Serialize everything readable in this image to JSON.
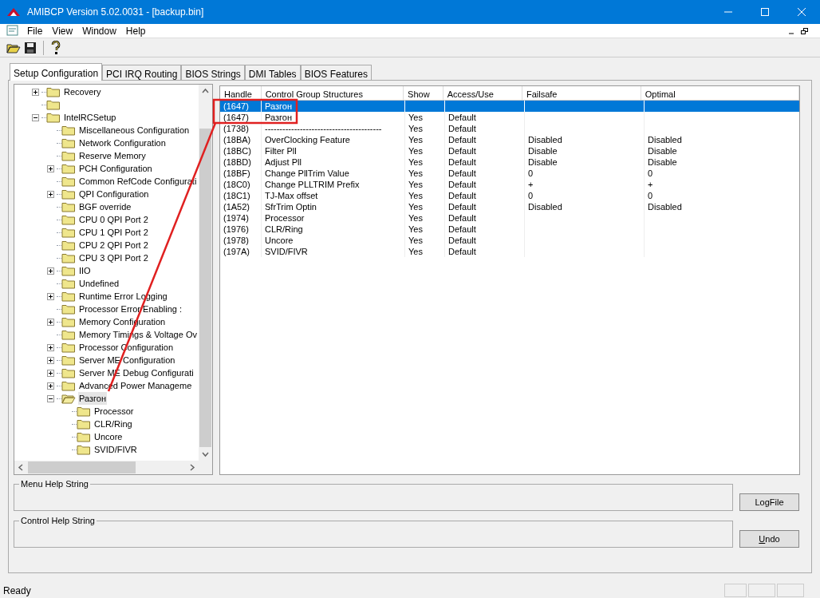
{
  "window": {
    "title": "AMIBCP Version 5.02.0031 - [backup.bin]"
  },
  "menu": [
    "File",
    "View",
    "Window",
    "Help"
  ],
  "tabs": [
    {
      "label": "Setup Configuration",
      "selected": true
    },
    {
      "label": "PCI IRQ Routing",
      "selected": false
    },
    {
      "label": "BIOS Strings",
      "selected": false
    },
    {
      "label": "DMI Tables",
      "selected": false
    },
    {
      "label": "BIOS Features",
      "selected": false
    }
  ],
  "tree": [
    {
      "label": "Recovery",
      "kind": "branch",
      "expanded": false,
      "selected": false
    },
    {
      "kind": "leaf",
      "selected": false
    },
    {
      "label": "IntelRCSetup",
      "kind": "branch",
      "expanded": true,
      "selected": false,
      "children": [
        {
          "label": "Miscellaneous Configuration",
          "kind": "leaf",
          "selected": false
        },
        {
          "label": "Network Configuration",
          "kind": "leaf",
          "selected": false
        },
        {
          "label": "Reserve Memory",
          "kind": "leaf",
          "selected": false
        },
        {
          "label": "PCH Configuration",
          "kind": "branch",
          "expanded": false,
          "selected": false
        },
        {
          "label": "Common RefCode Configurati",
          "kind": "leaf",
          "selected": false
        },
        {
          "label": "QPI Configuration",
          "kind": "branch",
          "expanded": false,
          "selected": false
        },
        {
          "label": "BGF override",
          "kind": "leaf",
          "selected": false
        },
        {
          "label": "CPU 0 QPI Port 2",
          "kind": "leaf",
          "selected": false
        },
        {
          "label": "CPU 1 QPI Port 2",
          "kind": "leaf",
          "selected": false
        },
        {
          "label": "CPU 2 QPI Port 2",
          "kind": "leaf",
          "selected": false
        },
        {
          "label": "CPU 3 QPI Port 2",
          "kind": "leaf",
          "selected": false
        },
        {
          "label": "IIO",
          "kind": "branch",
          "expanded": false,
          "selected": false
        },
        {
          "label": "Undefined",
          "kind": "leaf",
          "selected": false
        },
        {
          "label": "Runtime Error Logging",
          "kind": "branch",
          "expanded": false,
          "selected": false
        },
        {
          "label": "Processor Error Enabling :",
          "kind": "leaf",
          "selected": false
        },
        {
          "label": "Memory Configuration",
          "kind": "branch",
          "expanded": false,
          "selected": false
        },
        {
          "label": "Memory Timings & Voltage Ov",
          "kind": "leaf",
          "selected": false
        },
        {
          "label": "Processor Configuration",
          "kind": "branch",
          "expanded": false,
          "selected": false
        },
        {
          "label": "Server ME Configuration",
          "kind": "branch",
          "expanded": false,
          "selected": false
        },
        {
          "label": "Server ME Debug Configurati",
          "kind": "branch",
          "expanded": false,
          "selected": false
        },
        {
          "label": "Advanced Power Manageme",
          "kind": "branch",
          "expanded": false,
          "selected": false
        },
        {
          "label": "Разгон",
          "kind": "branch",
          "expanded": true,
          "selected": true,
          "children": [
            {
              "label": "Processor",
              "kind": "leaf",
              "selected": false
            },
            {
              "label": "CLR/Ring",
              "kind": "leaf",
              "selected": false
            },
            {
              "label": "Uncore",
              "kind": "leaf",
              "selected": false
            },
            {
              "label": "SVID/FIVR",
              "kind": "leaf",
              "selected": false
            }
          ]
        }
      ]
    }
  ],
  "table": {
    "columns": [
      "Handle",
      "Control Group Structures",
      "Show",
      "Access/Use",
      "Failsafe",
      "Optimal"
    ],
    "rows": [
      {
        "handle": "(1647)",
        "name": "Разгон",
        "selected": true
      },
      {
        "handle": "(1647)",
        "name": "Разгон",
        "show": "Yes",
        "access": "Default",
        "selected": false
      },
      {
        "handle": "(1738)",
        "name": "----------------------------------------",
        "show": "Yes",
        "access": "Default",
        "selected": false
      },
      {
        "handle": "(18BA)",
        "name": "OverClocking Feature",
        "show": "Yes",
        "access": "Default",
        "failsafe": "Disabled",
        "optimal": "Disabled",
        "selected": false
      },
      {
        "handle": "(18BC)",
        "name": "Filter Pll",
        "show": "Yes",
        "access": "Default",
        "failsafe": "Disable",
        "optimal": "Disable",
        "selected": false
      },
      {
        "handle": "(18BD)",
        "name": "Adjust Pll",
        "show": "Yes",
        "access": "Default",
        "failsafe": "Disable",
        "optimal": "Disable",
        "selected": false
      },
      {
        "handle": "(18BF)",
        "name": "Change PllTrim Value",
        "show": "Yes",
        "access": "Default",
        "failsafe": "0",
        "optimal": "0",
        "selected": false
      },
      {
        "handle": "(18C0)",
        "name": "Change PLLTRIM Prefix",
        "show": "Yes",
        "access": "Default",
        "failsafe": "+",
        "optimal": "+",
        "selected": false
      },
      {
        "handle": "(18C1)",
        "name": "TJ-Max offset",
        "show": "Yes",
        "access": "Default",
        "failsafe": "0",
        "optimal": "0",
        "selected": false
      },
      {
        "handle": "(1A52)",
        "name": "SfrTrim Optin",
        "show": "Yes",
        "access": "Default",
        "failsafe": "Disabled",
        "optimal": "Disabled",
        "selected": false
      },
      {
        "handle": "(1974)",
        "name": "Processor",
        "show": "Yes",
        "access": "Default",
        "selected": false
      },
      {
        "handle": "(1976)",
        "name": "CLR/Ring",
        "show": "Yes",
        "access": "Default",
        "selected": false
      },
      {
        "handle": "(1978)",
        "name": "Uncore",
        "show": "Yes",
        "access": "Default",
        "selected": false
      },
      {
        "handle": "(197A)",
        "name": "SVID/FIVR",
        "show": "Yes",
        "access": "Default",
        "selected": false
      }
    ]
  },
  "help_groups": [
    {
      "label": "Menu Help String",
      "button": "LogFile"
    },
    {
      "label": "Control Help String",
      "button": "Undo"
    }
  ],
  "status_bar": {
    "text": "Ready"
  }
}
